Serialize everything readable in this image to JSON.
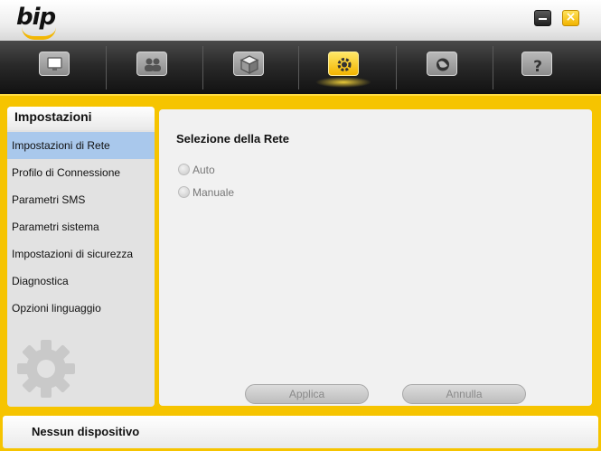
{
  "app": {
    "logo_text": "bip"
  },
  "window": {
    "minimize": "minimize",
    "close": "×"
  },
  "toolbar": {
    "items": [
      {
        "name": "monitor-icon"
      },
      {
        "name": "contacts-icon"
      },
      {
        "name": "box-icon"
      },
      {
        "name": "settings-folder-icon",
        "active": true
      },
      {
        "name": "globe-icon"
      },
      {
        "name": "help-icon"
      }
    ]
  },
  "sidebar": {
    "title": "Impostazioni",
    "items": [
      {
        "label": "Impostazioni di Rete",
        "active": true
      },
      {
        "label": "Profilo di Connessione"
      },
      {
        "label": "Parametri SMS"
      },
      {
        "label": "Parametri sistema"
      },
      {
        "label": "Impostazioni di sicurezza"
      },
      {
        "label": "Diagnostica"
      },
      {
        "label": "Opzioni linguaggio"
      }
    ]
  },
  "content": {
    "title": "Selezione della Rete",
    "options": [
      {
        "label": "Auto"
      },
      {
        "label": "Manuale"
      }
    ],
    "apply_label": "Applica",
    "cancel_label": "Annulla"
  },
  "status": {
    "text": "Nessun dispositivo"
  },
  "colors": {
    "accent": "#f6c400",
    "selected": "#a9c8ec",
    "toolbar": "#2a2a2a"
  }
}
